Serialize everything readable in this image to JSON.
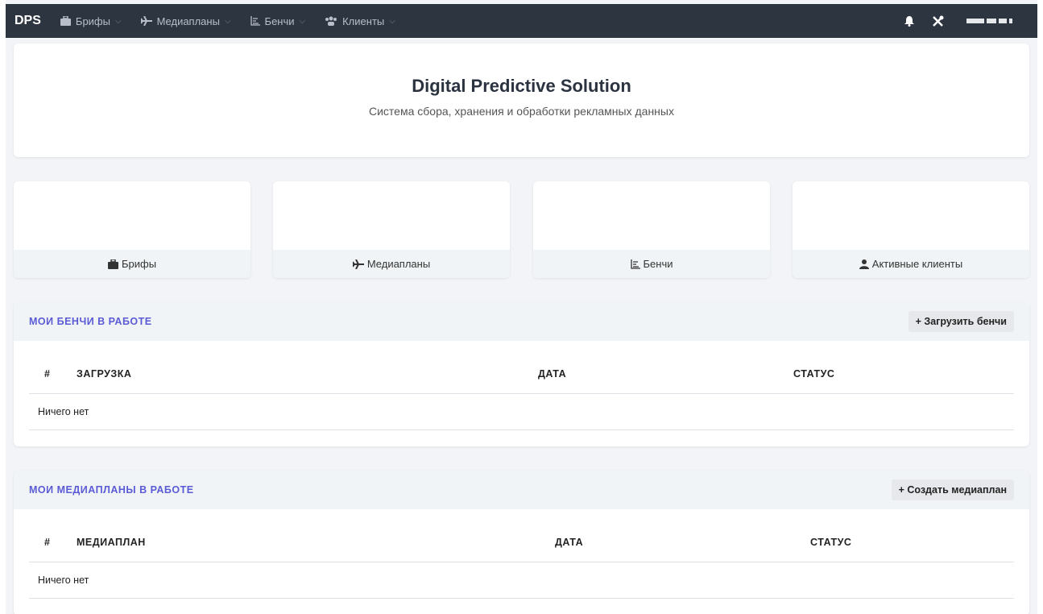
{
  "navbar": {
    "brand": "DPS",
    "items": [
      {
        "label": "Брифы",
        "icon": "briefcase-icon"
      },
      {
        "label": "Медиапланы",
        "icon": "plane-icon"
      },
      {
        "label": "Бенчи",
        "icon": "chart-icon"
      },
      {
        "label": "Клиенты",
        "icon": "users-icon"
      }
    ],
    "icons": [
      "bell-icon",
      "tools-icon"
    ]
  },
  "hero": {
    "title": "Digital Predictive Solution",
    "subtitle": "Система сбора, хранения и обработки рекламных данных"
  },
  "stats": [
    {
      "value": "",
      "label": "Брифы",
      "icon": "briefcase-icon"
    },
    {
      "value": "",
      "label": "Медиапланы",
      "icon": "plane-icon"
    },
    {
      "value": "",
      "label": "Бенчи",
      "icon": "chart-icon"
    },
    {
      "value": "",
      "label": "Активные клиенты",
      "icon": "user-icon"
    }
  ],
  "benchi_panel": {
    "title": "МОИ БЕНЧИ В РАБОТЕ",
    "button": "+ Загрузить бенчи",
    "columns": [
      "#",
      "ЗАГРУЗКА",
      "ДАТА",
      "СТАТУС"
    ],
    "empty": "Ничего нет"
  },
  "mediaplan_panel": {
    "title": "МОИ МЕДИАПЛАНЫ В РАБОТЕ",
    "button": "+ Создать медиаплан",
    "columns": [
      "#",
      "МЕДИАПЛАН",
      "ДАТА",
      "СТАТУС"
    ],
    "empty": "Ничего нет"
  },
  "colors": {
    "navbar": "#2d3540",
    "accent": "#5b5bd6",
    "panel_head": "#f1f4f6"
  }
}
